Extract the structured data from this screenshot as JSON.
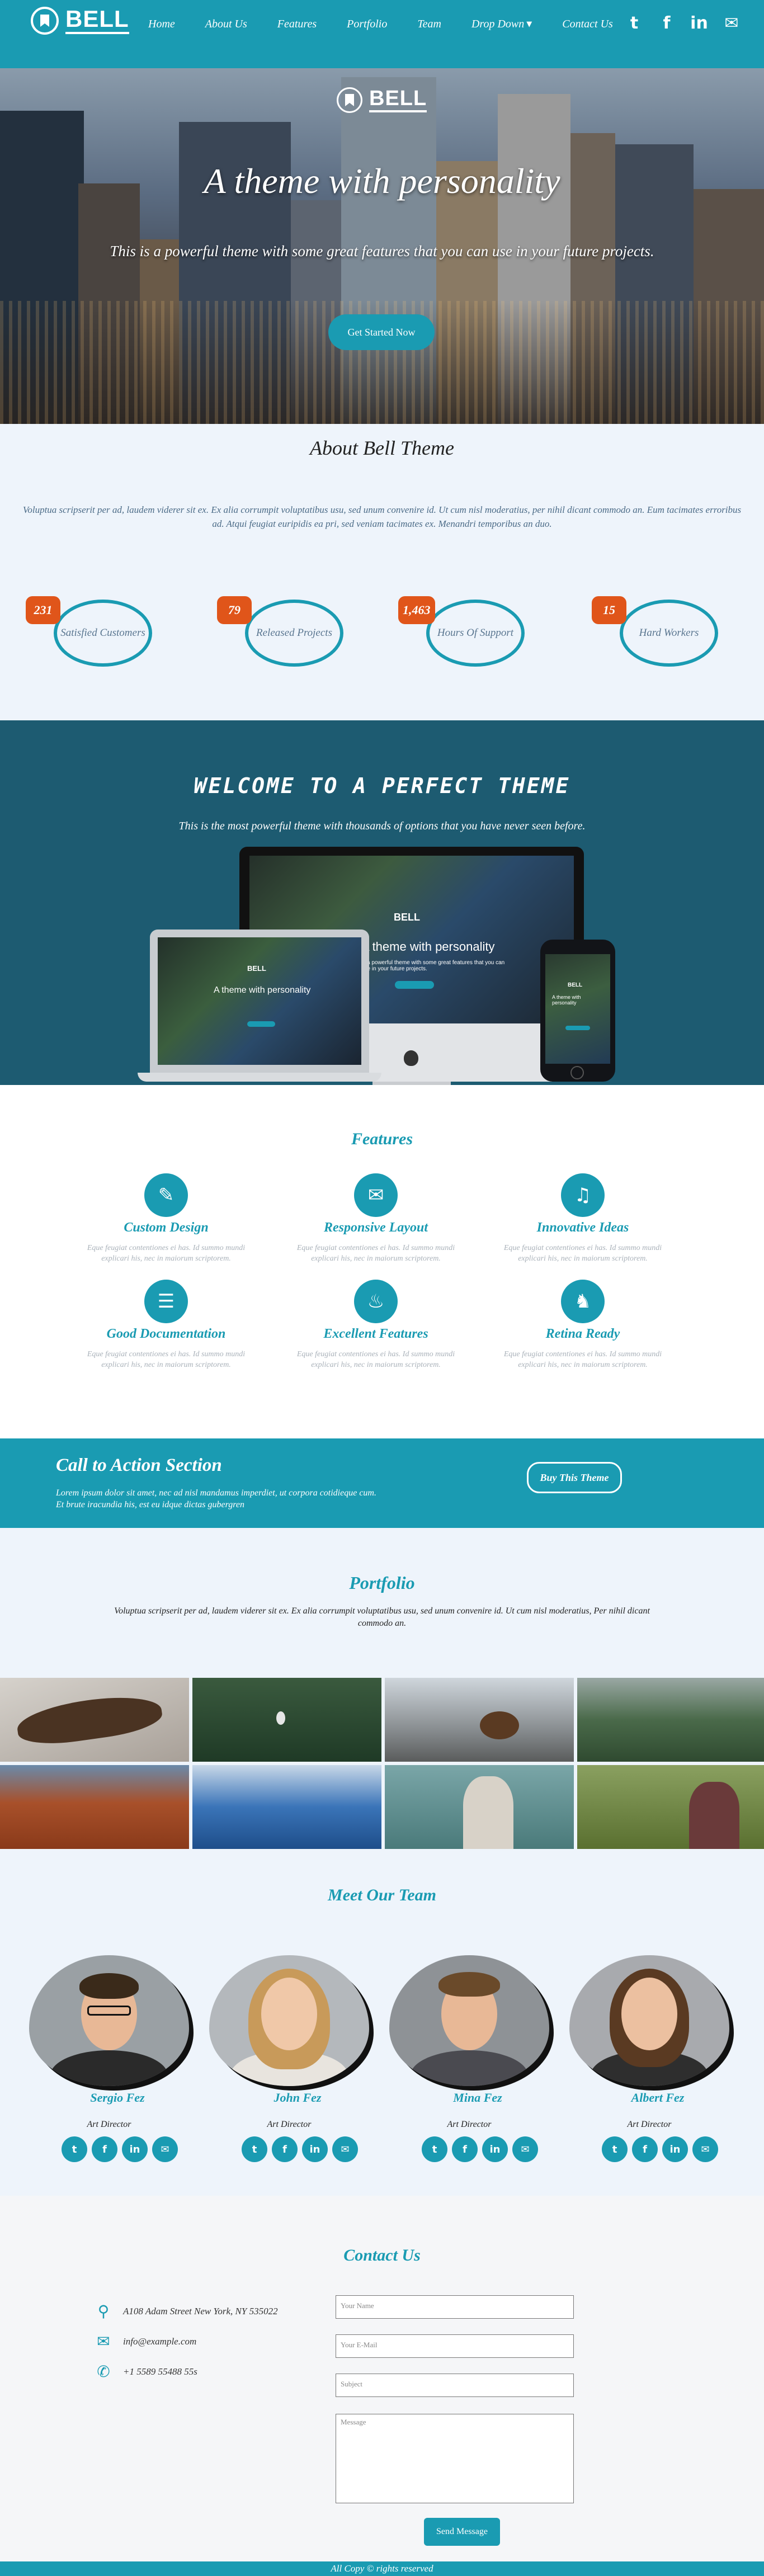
{
  "brand": {
    "name": "BELL"
  },
  "nav": {
    "links": [
      "Home",
      "About Us",
      "Features",
      "Portfolio",
      "Team",
      "Drop Down",
      "Contact Us"
    ],
    "social_icons": [
      "twitter-icon",
      "facebook-icon",
      "linkedin-icon",
      "mail-icon"
    ]
  },
  "hero": {
    "title": "A theme with personality",
    "subtitle": "This is a powerful theme with some great features that you can use in your future projects.",
    "button": "Get Started Now"
  },
  "about": {
    "title": "About Bell Theme",
    "text": "Voluptua scripserit per ad, laudem viderer sit ex. Ex alia corrumpit voluptatibus usu, sed unum convenire id. Ut cum nisl moderatius, per nihil dicant commodo an. Eum tacimates erroribus ad. Atqui feugiat euripidis ea pri, sed veniam tacimates ex. Menandri temporibus an duo.",
    "stats": [
      {
        "number": "231",
        "label": "Satisfied Customers"
      },
      {
        "number": "79",
        "label": "Released Projects"
      },
      {
        "number": "1,463",
        "label": "Hours Of Support"
      },
      {
        "number": "15",
        "label": "Hard Workers"
      }
    ]
  },
  "welcome": {
    "title": "WELCOME TO A PERFECT THEME",
    "subtitle": "This is the most powerful theme with thousands of options that you have never seen before.",
    "screen_brand": "BELL",
    "screen_title": "A theme with personality",
    "screen_sub": "is a powerful theme with some great features that you can use in your future projects."
  },
  "features": {
    "title": "Features",
    "items": [
      {
        "title": "Custom Design",
        "icon": "paint-brush-icon",
        "text": "Eque feugiat contentiones ei has. Id summo mundi explicari his, nec in maiorum scriptorem."
      },
      {
        "title": "Responsive Layout",
        "icon": "envelope-icon",
        "text": "Eque feugiat contentiones ei has. Id summo mundi explicari his, nec in maiorum scriptorem."
      },
      {
        "title": "Innovative Ideas",
        "icon": "bell-icon",
        "text": "Eque feugiat contentiones ei has. Id summo mundi explicari his, nec in maiorum scriptorem."
      },
      {
        "title": "Good Documentation",
        "icon": "database-icon",
        "text": "Eque feugiat contentiones ei has. Id summo mundi explicari his, nec in maiorum scriptorem."
      },
      {
        "title": "Excellent Features",
        "icon": "cutlery-icon",
        "text": "Eque feugiat contentiones ei has. Id summo mundi explicari his, nec in maiorum scriptorem."
      },
      {
        "title": "Retina Ready",
        "icon": "runner-icon",
        "text": "Eque feugiat contentiones ei has. Id summo mundi explicari his, nec in maiorum scriptorem."
      }
    ]
  },
  "cta": {
    "title": "Call to Action Section",
    "text_line1": "Lorem ipsum dolor sit amet, nec ad nisl mandamus imperdiet, ut corpora cotidieque cum.",
    "text_line2": "Et brute iracundia his, est eu idque dictas gubergren",
    "button": "Buy This Theme"
  },
  "portfolio": {
    "title": "Portfolio",
    "text": "Voluptua scripserit per ad, laudem viderer sit ex. Ex alia corrumpit voluptatibus usu, sed unum convenire id. Ut cum nisl moderatius, Per nihil dicant commodo an."
  },
  "team": {
    "title": "Meet Our Team",
    "members": [
      {
        "name": "Sergio Fez",
        "role": "Art Director"
      },
      {
        "name": "John Fez",
        "role": "Art Director"
      },
      {
        "name": "Mina Fez",
        "role": "Art Director"
      },
      {
        "name": "Albert Fez",
        "role": "Art Director"
      }
    ]
  },
  "contact": {
    "title": "Contact Us",
    "address": "A108 Adam Street New York, NY 535022",
    "email": "info@example.com",
    "phone": "+1 5589 55488 55s",
    "placeholders": {
      "name": "Your Name",
      "email": "Your E-Mail",
      "subject": "Subject",
      "message": "Message"
    },
    "button": "Send Message"
  },
  "footer": {
    "text": "All Copy © rights reserved"
  },
  "colors": {
    "accent": "#1a9bb2",
    "dark_teal": "#1d5b71",
    "badge": "#e0551a",
    "light_bg": "#eef4fb"
  }
}
